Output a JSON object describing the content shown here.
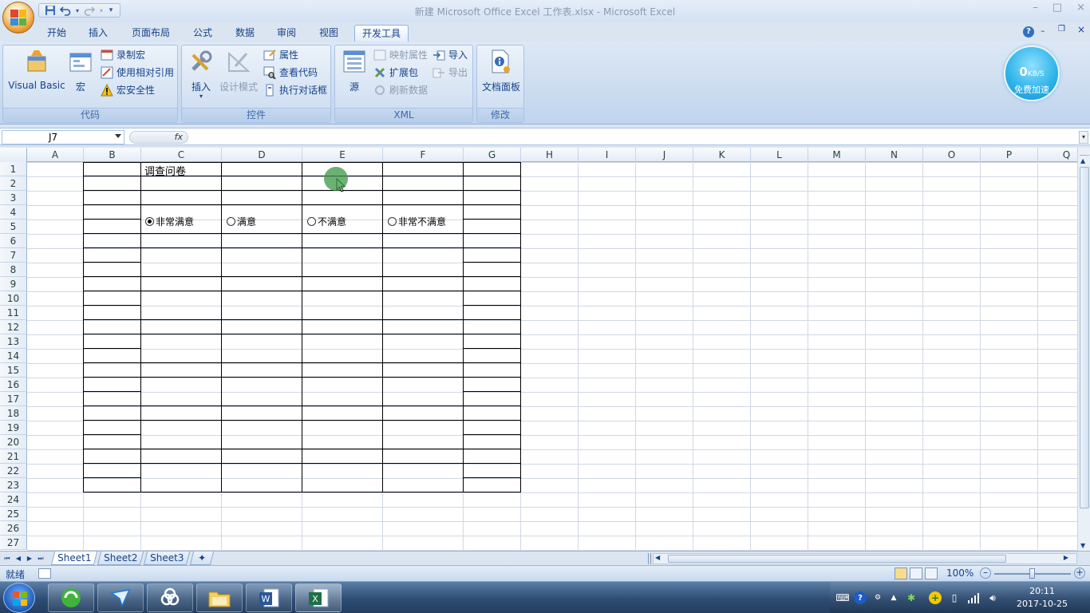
{
  "window": {
    "title": "新建 Microsoft Office Excel 工作表.xlsx - Microsoft Excel",
    "minimize": "–",
    "maximize": "□",
    "close": "×"
  },
  "ribbon_tabs": [
    "开始",
    "插入",
    "页面布局",
    "公式",
    "数据",
    "审阅",
    "视图",
    "开发工具"
  ],
  "active_tab": "开发工具",
  "ribbon": {
    "code": {
      "label": "代码",
      "visual_basic": "Visual Basic",
      "macro": "宏",
      "record_macro": "录制宏",
      "relative_ref": "使用相对引用",
      "macro_security": "宏安全性"
    },
    "controls": {
      "label": "控件",
      "insert": "插入",
      "design_mode": "设计模式",
      "properties": "属性",
      "view_code": "查看代码",
      "run_dialog": "执行对话框"
    },
    "xml": {
      "label": "XML",
      "source": "源",
      "map_props": "映射属性",
      "expansion": "扩展包",
      "refresh": "刷新数据",
      "import": "导入",
      "export": "导出"
    },
    "modify": {
      "label": "修改",
      "doc_panel": "文档面板"
    }
  },
  "speed_widget": {
    "value": "0",
    "unit": "KB/S",
    "label": "免费加速"
  },
  "formula_bar": {
    "name_box": "J7",
    "fx": "fx",
    "formula": ""
  },
  "columns": [
    "A",
    "B",
    "C",
    "D",
    "E",
    "F",
    "G",
    "H",
    "I",
    "J",
    "K",
    "L",
    "M",
    "N",
    "O",
    "P",
    "Q"
  ],
  "rows": [
    "1",
    "2",
    "3",
    "4",
    "5",
    "6",
    "7",
    "8",
    "9",
    "10",
    "11",
    "12",
    "13",
    "14",
    "15",
    "16",
    "17",
    "18",
    "19",
    "20",
    "21",
    "22",
    "23",
    "24",
    "25",
    "26",
    "27"
  ],
  "cells": {
    "C1": "调查问卷"
  },
  "options": [
    {
      "label": "非常满意",
      "selected": true
    },
    {
      "label": "满意",
      "selected": false
    },
    {
      "label": "不满意",
      "selected": false
    },
    {
      "label": "非常不满意",
      "selected": false
    }
  ],
  "sheets": [
    "Sheet1",
    "Sheet2",
    "Sheet3"
  ],
  "active_sheet": "Sheet1",
  "status": {
    "ready": "就绪",
    "zoom": "100%"
  },
  "clock": {
    "time": "20:11",
    "date": "2017-10-25"
  }
}
